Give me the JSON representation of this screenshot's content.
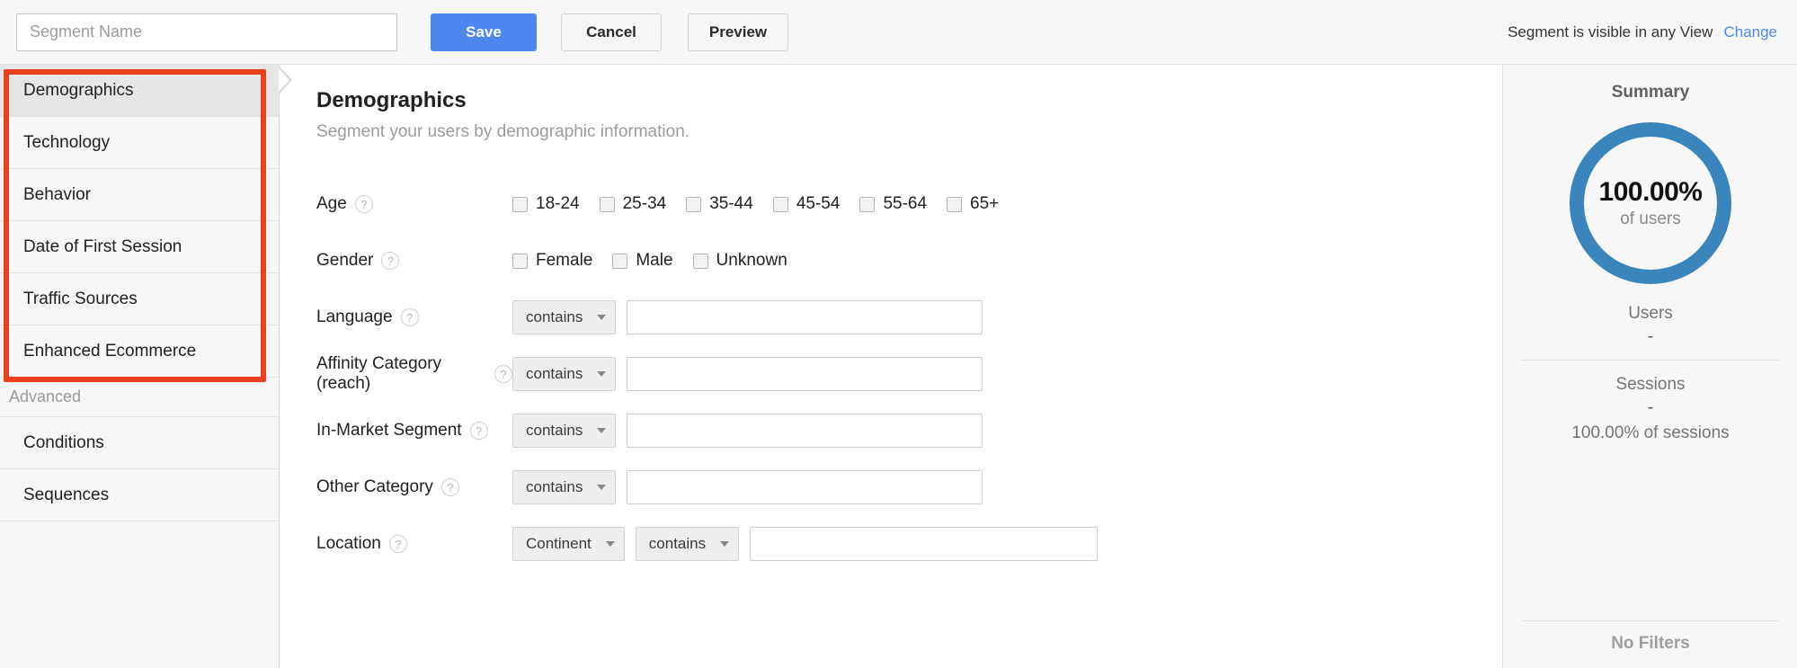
{
  "toolbar": {
    "segment_name_placeholder": "Segment Name",
    "segment_name_value": "",
    "save_label": "Save",
    "cancel_label": "Cancel",
    "preview_label": "Preview",
    "visibility_text": "Segment is visible in any View",
    "change_label": "Change",
    "accent_color": "#4d87ee"
  },
  "sidebar": {
    "items": [
      {
        "label": "Demographics",
        "selected": true
      },
      {
        "label": "Technology",
        "selected": false
      },
      {
        "label": "Behavior",
        "selected": false
      },
      {
        "label": "Date of First Session",
        "selected": false
      },
      {
        "label": "Traffic Sources",
        "selected": false
      },
      {
        "label": "Enhanced Ecommerce",
        "selected": false
      }
    ],
    "advanced_label": "Advanced",
    "advanced_items": [
      {
        "label": "Conditions"
      },
      {
        "label": "Sequences"
      }
    ],
    "annotation_color": "#ec3f1d"
  },
  "main": {
    "title": "Demographics",
    "subtitle": "Segment your users by demographic information.",
    "help_glyph": "?",
    "age": {
      "label": "Age",
      "options": [
        "18-24",
        "25-34",
        "35-44",
        "45-54",
        "55-64",
        "65+"
      ],
      "checked": []
    },
    "gender": {
      "label": "Gender",
      "options": [
        "Female",
        "Male",
        "Unknown"
      ],
      "checked": []
    },
    "language": {
      "label": "Language",
      "operator": "contains",
      "value": ""
    },
    "affinity": {
      "label": "Affinity Category (reach)",
      "operator": "contains",
      "value": ""
    },
    "in_market": {
      "label": "In-Market Segment",
      "operator": "contains",
      "value": ""
    },
    "other_category": {
      "label": "Other Category",
      "operator": "contains",
      "value": ""
    },
    "location": {
      "label": "Location",
      "dimension": "Continent",
      "operator": "contains",
      "value": ""
    }
  },
  "summary": {
    "title": "Summary",
    "donut_percent_label": "100.00%",
    "donut_percent_value": 100,
    "donut_sub": "of users",
    "donut_color": "#3b85bd",
    "users": {
      "name": "Users",
      "value": "-"
    },
    "sessions": {
      "name": "Sessions",
      "value": "-",
      "extra": "100.00% of sessions"
    },
    "no_filters_label": "No Filters"
  }
}
